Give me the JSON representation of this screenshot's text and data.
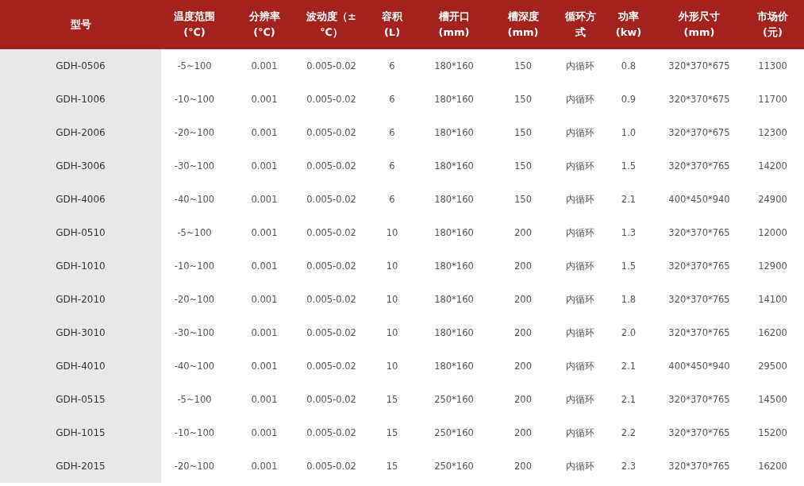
{
  "table": {
    "columns": [
      {
        "lines": [
          "型号"
        ]
      },
      {
        "lines": [
          "温度范围",
          "(℃)"
        ]
      },
      {
        "lines": [
          "分辨率",
          "(℃)"
        ]
      },
      {
        "lines": [
          "波动度（±",
          "℃）"
        ]
      },
      {
        "lines": [
          "容积",
          "(L)"
        ]
      },
      {
        "lines": [
          "槽开口",
          "(mm)"
        ]
      },
      {
        "lines": [
          "槽深度",
          "(mm)"
        ]
      },
      {
        "lines": [
          "循环方",
          "式"
        ]
      },
      {
        "lines": [
          "功率",
          "(kw)"
        ]
      },
      {
        "lines": [
          "外形尺寸",
          "(mm)"
        ]
      },
      {
        "lines": [
          "市场价",
          "(元)"
        ]
      }
    ],
    "rows": [
      [
        "GDH-0506",
        "-5~100",
        "0.001",
        "0.005-0.02",
        "6",
        "180*160",
        "150",
        "内循环",
        "0.8",
        "320*370*675",
        "11300"
      ],
      [
        "GDH-1006",
        "-10~100",
        "0.001",
        "0.005-0.02",
        "6",
        "180*160",
        "150",
        "内循环",
        "0.9",
        "320*370*675",
        "11700"
      ],
      [
        "GDH-2006",
        "-20~100",
        "0.001",
        "0.005-0.02",
        "6",
        "180*160",
        "150",
        "内循环",
        "1.0",
        "320*370*675",
        "12300"
      ],
      [
        "GDH-3006",
        "-30~100",
        "0.001",
        "0.005-0.02",
        "6",
        "180*160",
        "150",
        "内循环",
        "1.5",
        "320*370*765",
        "14200"
      ],
      [
        "GDH-4006",
        "-40~100",
        "0.001",
        "0.005-0.02",
        "6",
        "180*160",
        "150",
        "内循环",
        "2.1",
        "400*450*940",
        "24900"
      ],
      [
        "GDH-0510",
        "-5~100",
        "0.001",
        "0.005-0.02",
        "10",
        "180*160",
        "200",
        "内循环",
        "1.3",
        "320*370*765",
        "12000"
      ],
      [
        "GDH-1010",
        "-10~100",
        "0.001",
        "0.005-0.02",
        "10",
        "180*160",
        "200",
        "内循环",
        "1.5",
        "320*370*765",
        "12900"
      ],
      [
        "GDH-2010",
        "-20~100",
        "0.001",
        "0.005-0.02",
        "10",
        "180*160",
        "200",
        "内循环",
        "1.8",
        "320*370*765",
        "14100"
      ],
      [
        "GDH-3010",
        "-30~100",
        "0.001",
        "0.005-0.02",
        "10",
        "180*160",
        "200",
        "内循环",
        "2.0",
        "320*370*765",
        "16200"
      ],
      [
        "GDH-4010",
        "-40~100",
        "0.001",
        "0.005-0.02",
        "10",
        "180*160",
        "200",
        "内循环",
        "2.1",
        "400*450*940",
        "29500"
      ],
      [
        "GDH-0515",
        "-5~100",
        "0.001",
        "0.005-0.02",
        "15",
        "250*160",
        "200",
        "内循环",
        "2.1",
        "320*370*765",
        "14500"
      ],
      [
        "GDH-1015",
        "-10~100",
        "0.001",
        "0.005-0.02",
        "15",
        "250*160",
        "200",
        "内循环",
        "2.2",
        "320*370*765",
        "15200"
      ],
      [
        "GDH-2015",
        "-20~100",
        "0.001",
        "0.005-0.02",
        "15",
        "250*160",
        "200",
        "内循环",
        "2.3",
        "320*370*765",
        "16200"
      ]
    ]
  }
}
